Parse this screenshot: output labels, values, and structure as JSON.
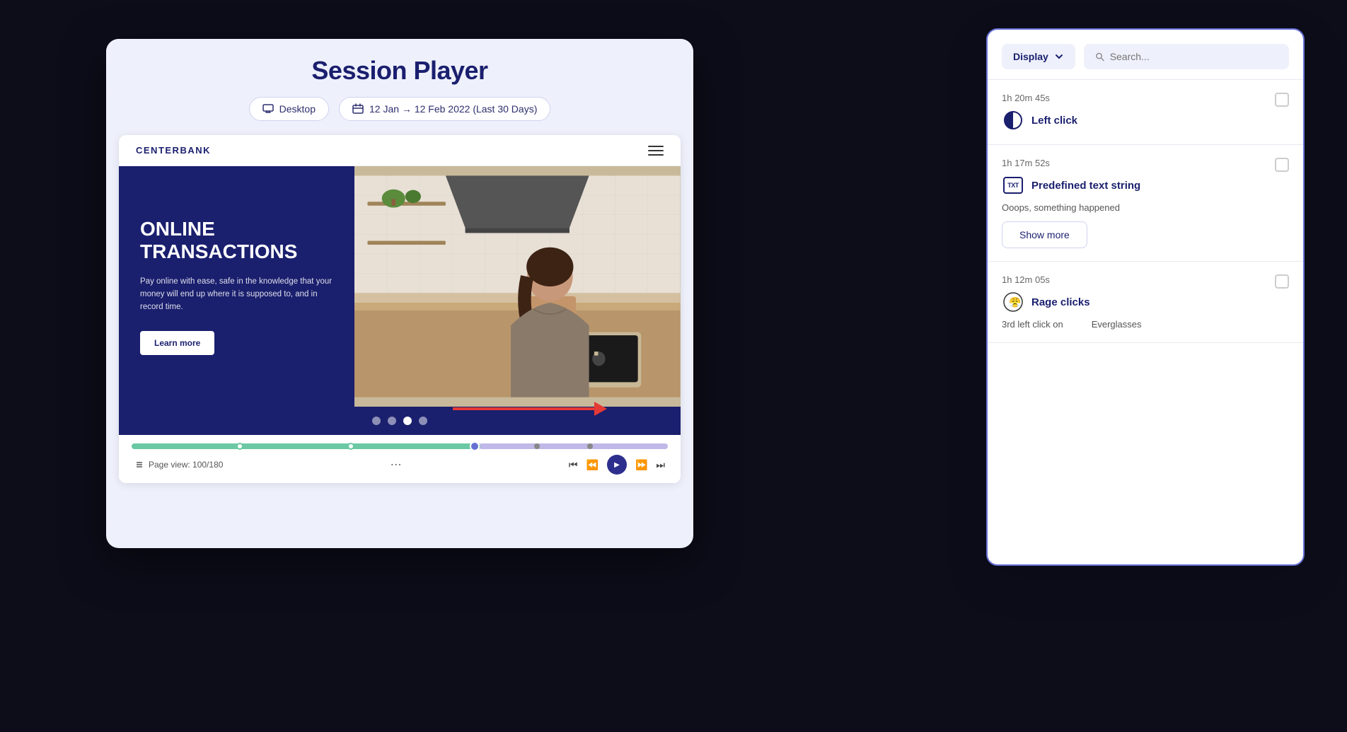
{
  "browser": {
    "title": "Session Player",
    "device_label": "Desktop",
    "date_range": "12 Jan → 12 Feb 2022 (Last 30 Days)"
  },
  "website": {
    "brand": "CENTERBANK",
    "hero_title": "ONLINE\nTRANSACTIONS",
    "hero_desc": "Pay online with ease, safe in the knowledge that your money will end up where it is supposed to, and in record time.",
    "cta_label": "Learn more",
    "dots": [
      "inactive",
      "inactive",
      "active",
      "inactive"
    ]
  },
  "player": {
    "page_view": "Page view: 100/180",
    "more_icon": "⋯"
  },
  "panel": {
    "display_label": "Display",
    "search_placeholder": "Search...",
    "events": [
      {
        "time": "1h 20m 45s",
        "icon": "half-circle",
        "label": "Left click",
        "subtext": null,
        "show_more": false
      },
      {
        "time": "1h 17m 52s",
        "icon": "txt",
        "label": "Predefined text string",
        "subtext": "Ooops, something happened",
        "show_more": true,
        "show_more_label": "Show more"
      },
      {
        "time": "1h 12m 05s",
        "icon": "rage",
        "label": "Rage clicks",
        "sub_detail_left": "3rd left click on",
        "sub_detail_right": "Everglasses",
        "show_more": false
      }
    ]
  }
}
